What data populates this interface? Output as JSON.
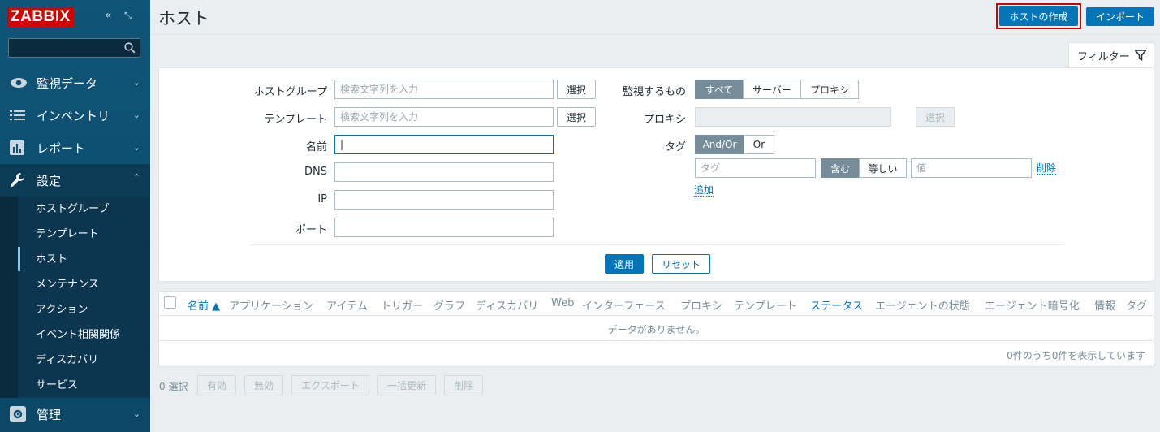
{
  "sidebar": {
    "logo": "ZABBIX",
    "menu": [
      {
        "label": "監視データ"
      },
      {
        "label": "インベントリ"
      },
      {
        "label": "レポート"
      },
      {
        "label": "設定"
      },
      {
        "label": "管理"
      }
    ],
    "submenu": [
      {
        "label": "ホストグループ"
      },
      {
        "label": "テンプレート"
      },
      {
        "label": "ホスト"
      },
      {
        "label": "メンテナンス"
      },
      {
        "label": "アクション"
      },
      {
        "label": "イベント相関関係"
      },
      {
        "label": "ディスカバリ"
      },
      {
        "label": "サービス"
      }
    ]
  },
  "header": {
    "title": "ホスト",
    "create_button": "ホストの作成",
    "import_button": "インポート"
  },
  "filter": {
    "tab_label": "フィルター",
    "host_group_label": "ホストグループ",
    "host_group_placeholder": "検索文字列を入力",
    "template_label": "テンプレート",
    "template_placeholder": "検索文字列を入力",
    "select_button": "選択",
    "name_label": "名前",
    "dns_label": "DNS",
    "ip_label": "IP",
    "port_label": "ポート",
    "monitored_by_label": "監視するもの",
    "monitored_by_options": [
      "すべて",
      "サーバー",
      "プロキシ"
    ],
    "monitored_by_selected": "すべて",
    "proxy_label": "プロキシ",
    "tags_label": "タグ",
    "tags_operator_options": [
      "And/Or",
      "Or"
    ],
    "tag_placeholder": "タグ",
    "tag_match_options": [
      "含む",
      "等しい"
    ],
    "value_placeholder": "値",
    "remove_link": "削除",
    "add_link": "追加",
    "apply_button": "適用",
    "reset_button": "リセット"
  },
  "table": {
    "columns": [
      "名前 ▲",
      "アプリケーション",
      "アイテム",
      "トリガー",
      "グラフ",
      "ディスカバリ",
      "Web",
      "インターフェース",
      "プロキシ",
      "テンプレート",
      "ステータス",
      "エージェントの状態",
      "エージェント暗号化",
      "情報",
      "タグ"
    ],
    "no_data": "データがありません。",
    "paging": "0件のうち0件を表示しています"
  },
  "actions": {
    "selected_count": "0 選択",
    "buttons": [
      "有効",
      "無効",
      "エクスポート",
      "一括更新",
      "削除"
    ]
  },
  "colors": {
    "brand": "#d40000",
    "primary": "#0275b8",
    "sidebar": "#0e5073"
  }
}
